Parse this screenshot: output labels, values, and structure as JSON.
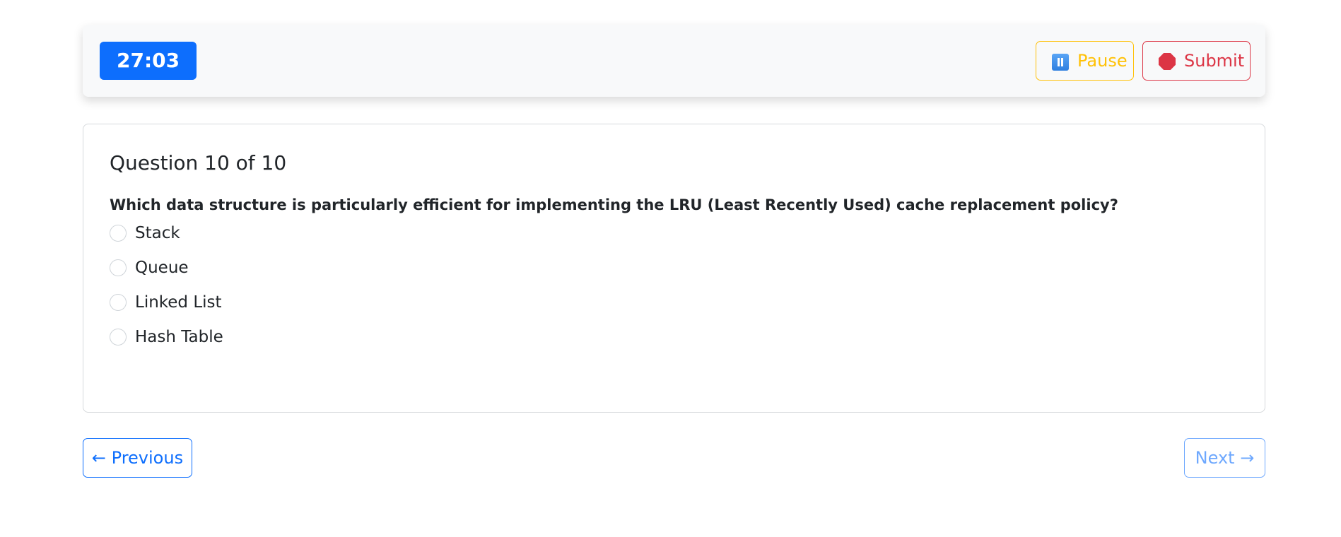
{
  "header": {
    "timer": "27:03",
    "pause_label": "Pause",
    "submit_label": "Submit"
  },
  "question": {
    "title": "Question 10 of 10",
    "text": "Which data structure is particularly efficient for implementing the LRU (Least Recently Used) cache replacement policy?",
    "options": [
      {
        "label": "Stack",
        "selected": false
      },
      {
        "label": "Queue",
        "selected": false
      },
      {
        "label": "Linked List",
        "selected": false
      },
      {
        "label": "Hash Table",
        "selected": false
      }
    ]
  },
  "navigation": {
    "previous_label": "← Previous",
    "next_label": "Next →"
  },
  "colors": {
    "timer_bg": "#0d6efd",
    "pause": "#ffc107",
    "submit": "#dc3545",
    "nav_primary": "#0d6efd",
    "nav_disabled": "#6ea8fe"
  },
  "icons": {
    "pause": "pause-icon",
    "submit": "stop-icon"
  }
}
